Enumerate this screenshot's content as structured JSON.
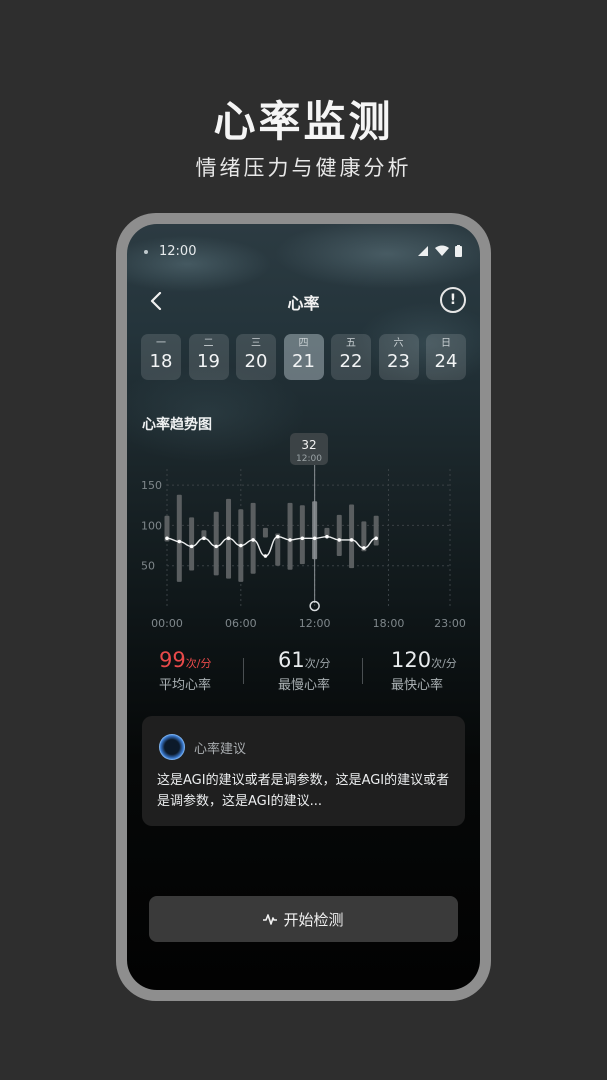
{
  "promo": {
    "title": "心率监测",
    "subtitle": "情绪压力与健康分析"
  },
  "status_bar": {
    "time": "12:00",
    "icons": [
      "signal-icon",
      "wifi-icon",
      "battery-icon"
    ]
  },
  "nav": {
    "back_icon": "chevron-left-icon",
    "title": "心率",
    "info_label": "!"
  },
  "dates": [
    {
      "weekday": "一",
      "day": "18",
      "selected": false
    },
    {
      "weekday": "二",
      "day": "19",
      "selected": false
    },
    {
      "weekday": "三",
      "day": "20",
      "selected": false
    },
    {
      "weekday": "四",
      "day": "21",
      "selected": true
    },
    {
      "weekday": "五",
      "day": "22",
      "selected": false
    },
    {
      "weekday": "六",
      "day": "23",
      "selected": false
    },
    {
      "weekday": "日",
      "day": "24",
      "selected": false
    }
  ],
  "chart": {
    "title": "心率趋势图",
    "tooltip_value": "32",
    "tooltip_time": "12:00"
  },
  "chart_data": {
    "type": "bar",
    "ylim": [
      0,
      170
    ],
    "y_ticks": [
      "150",
      "100",
      "50"
    ],
    "x_ticks": [
      "00:00",
      "06:00",
      "12:00",
      "18:00",
      "23:00"
    ],
    "x_range": [
      0,
      23
    ],
    "selected_hour": 12,
    "ranges": [
      {
        "hour": 0,
        "low": 80,
        "high": 112
      },
      {
        "hour": 1,
        "low": 30,
        "high": 138
      },
      {
        "hour": 2,
        "low": 44,
        "high": 110
      },
      {
        "hour": 3,
        "low": 82,
        "high": 94
      },
      {
        "hour": 4,
        "low": 38,
        "high": 117
      },
      {
        "hour": 5,
        "low": 34,
        "high": 133
      },
      {
        "hour": 6,
        "low": 30,
        "high": 120
      },
      {
        "hour": 7,
        "low": 40,
        "high": 128
      },
      {
        "hour": 8,
        "low": 85,
        "high": 97
      },
      {
        "hour": 9,
        "low": 50,
        "high": 90
      },
      {
        "hour": 10,
        "low": 45,
        "high": 128
      },
      {
        "hour": 11,
        "low": 52,
        "high": 125
      },
      {
        "hour": 12,
        "low": 58,
        "high": 130
      },
      {
        "hour": 13,
        "low": 87,
        "high": 97
      },
      {
        "hour": 14,
        "low": 62,
        "high": 113
      },
      {
        "hour": 15,
        "low": 47,
        "high": 126
      },
      {
        "hour": 16,
        "low": 68,
        "high": 105
      },
      {
        "hour": 17,
        "low": 75,
        "high": 112
      }
    ],
    "trend": [
      {
        "hour": 0,
        "value": 84
      },
      {
        "hour": 1,
        "value": 80
      },
      {
        "hour": 2,
        "value": 74
      },
      {
        "hour": 3,
        "value": 84
      },
      {
        "hour": 4,
        "value": 74
      },
      {
        "hour": 5,
        "value": 84
      },
      {
        "hour": 6,
        "value": 75
      },
      {
        "hour": 7,
        "value": 82
      },
      {
        "hour": 8,
        "value": 62
      },
      {
        "hour": 9,
        "value": 86
      },
      {
        "hour": 10,
        "value": 82
      },
      {
        "hour": 11,
        "value": 84
      },
      {
        "hour": 12,
        "value": 84
      },
      {
        "hour": 13,
        "value": 86
      },
      {
        "hour": 14,
        "value": 82
      },
      {
        "hour": 15,
        "value": 82
      },
      {
        "hour": 16,
        "value": 72
      },
      {
        "hour": 17,
        "value": 84
      }
    ]
  },
  "stats": [
    {
      "value": "99",
      "unit": "次/分",
      "label": "平均心率",
      "accent": true
    },
    {
      "value": "61",
      "unit": "次/分",
      "label": "最慢心率",
      "accent": false
    },
    {
      "value": "120",
      "unit": "次/分",
      "label": "最快心率",
      "accent": false
    }
  ],
  "advice": {
    "title": "心率建议",
    "body": "这是AGI的建议或者是调参数，这是AGI的建议或者是调参数，这是AGI的建议..."
  },
  "start_button": {
    "icon": "pulse-icon",
    "label": "开始检测"
  },
  "colors": {
    "accent": "#e84a4a",
    "background": "#2e2e2e",
    "card": "#1f1f1f",
    "button": "#3a3a3a"
  }
}
